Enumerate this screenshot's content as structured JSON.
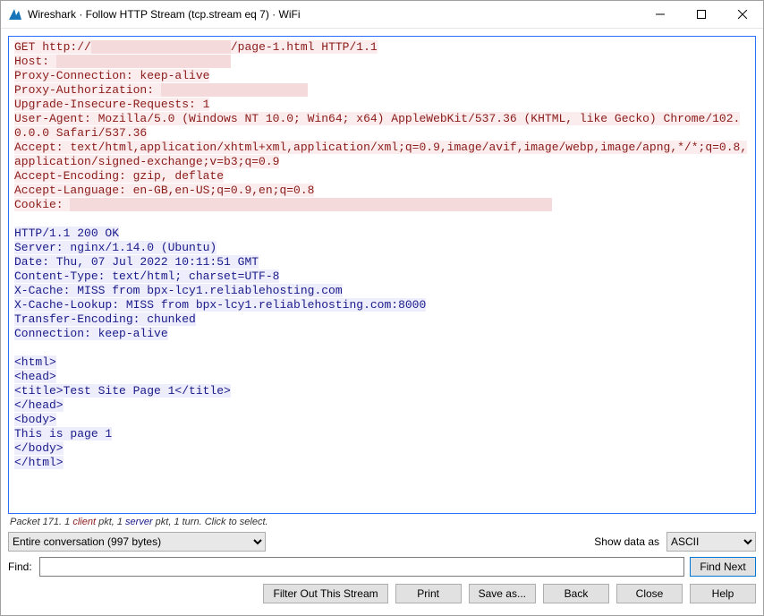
{
  "titlebar": {
    "title": "Wireshark · Follow HTTP Stream (tcp.stream eq 7) · WiFi"
  },
  "request": {
    "line1_a": "GET http://",
    "line1_redact": "                    ",
    "line1_b": "/page-1.html HTTP/1.1",
    "host_label": "Host: ",
    "host_redact": "                         ",
    "proxy_conn": "Proxy-Connection: keep-alive",
    "proxy_auth_label": "Proxy-Authorization: ",
    "proxy_auth_redact": "                     ",
    "upgrade": "Upgrade-Insecure-Requests: 1",
    "ua": "User-Agent: Mozilla/5.0 (Windows NT 10.0; Win64; x64) AppleWebKit/537.36 (KHTML, like Gecko) Chrome/102.0.0.0 Safari/537.36",
    "accept": "Accept: text/html,application/xhtml+xml,application/xml;q=0.9,image/avif,image/webp,image/apng,*/*;q=0.8,application/signed-exchange;v=b3;q=0.9",
    "accept_enc": "Accept-Encoding: gzip, deflate",
    "accept_lang": "Accept-Language: en-GB,en-US;q=0.9,en;q=0.8",
    "cookie_label": "Cookie: ",
    "cookie_redact": "                                                                     "
  },
  "response": {
    "status": "HTTP/1.1 200 OK",
    "server": "Server: nginx/1.14.0 (Ubuntu)",
    "date": "Date: Thu, 07 Jul 2022 10:11:51 GMT",
    "ctype": "Content-Type: text/html; charset=UTF-8",
    "xcache": "X-Cache: MISS from bpx-lcy1.reliablehosting.com",
    "xcache_lookup": "X-Cache-Lookup: MISS from bpx-lcy1.reliablehosting.com:8000",
    "te": "Transfer-Encoding: chunked",
    "conn": "Connection: keep-alive",
    "body1": "<html>",
    "body2": "<head>",
    "body3": "<title>Test Site Page 1</title>",
    "body4": "</head>",
    "body5": "<body>",
    "body6": "This is page 1",
    "body7": "</body>",
    "body8": "</html>"
  },
  "status": {
    "a": "Packet 171. 1 ",
    "client": "client",
    "b": " pkt, 1 ",
    "server": "server",
    "c": " pkt, 1 turn. Click to select."
  },
  "controls": {
    "conversation": "Entire conversation (997 bytes)",
    "show_as_label": "Show data as",
    "show_as_value": "ASCII",
    "find_label": "Find:",
    "find_next": "Find Next",
    "filter_out": "Filter Out This Stream",
    "print": "Print",
    "save_as": "Save as...",
    "back": "Back",
    "close": "Close",
    "help": "Help"
  }
}
